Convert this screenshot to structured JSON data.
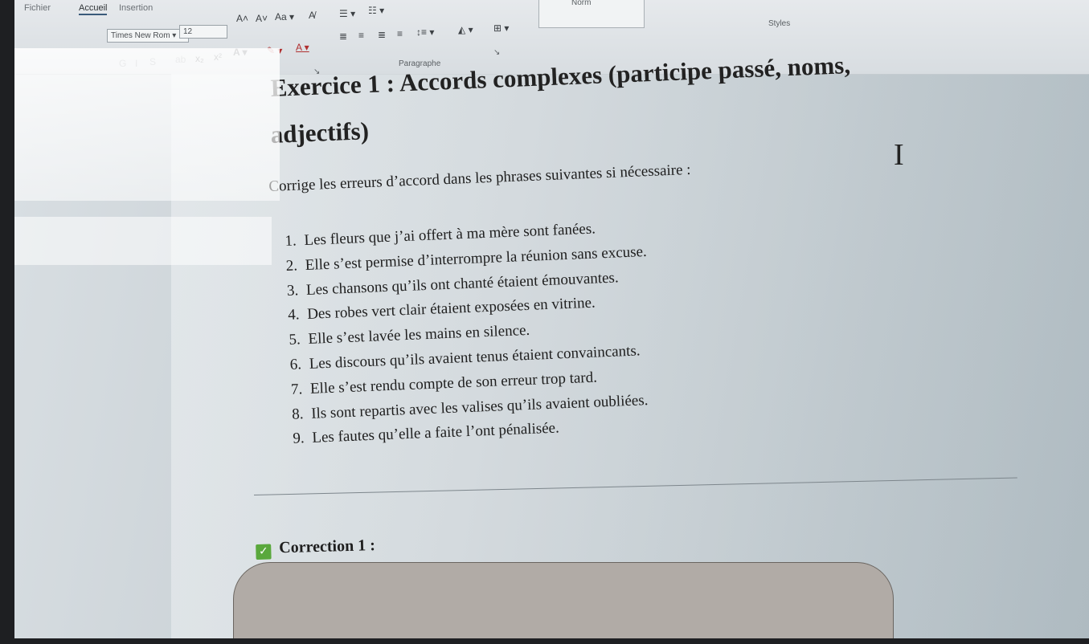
{
  "ribbon": {
    "tabs": [
      "Fichier",
      "Accueil",
      "Insertion"
    ],
    "font_name": "Times New Rom",
    "font_size": "12",
    "labels": {
      "paragraph": "Paragraphe",
      "styles": "Styles",
      "style_name": "Norm"
    },
    "buttons": {
      "grow": "A˄",
      "shrink": "A˅",
      "case": "Aa ▾",
      "bold": "G",
      "italic": "I",
      "underline": "S",
      "strike": "ab",
      "subscript": "x₂",
      "superscript": "x²"
    }
  },
  "document": {
    "title_line1": "Exercice 1 : Accords complexes (participe passé, noms,",
    "title_line2": "adjectifs)",
    "instruction": "Corrige les erreurs d’accord dans les phrases suivantes si nécessaire :",
    "items": [
      {
        "num": "1.",
        "text": "Les fleurs que j’ai offert à ma mère sont fanées."
      },
      {
        "num": "2.",
        "text": "Elle s’est permise d’interrompre la réunion sans excuse."
      },
      {
        "num": "3.",
        "text": "Les chansons qu’ils ont chanté étaient émouvantes."
      },
      {
        "num": "4.",
        "text": "Des robes vert clair étaient exposées en vitrine."
      },
      {
        "num": "5.",
        "text": "Elle s’est lavée les mains en silence."
      },
      {
        "num": "6.",
        "text": "Les discours qu’ils avaient tenus étaient convaincants."
      },
      {
        "num": "7.",
        "text": "Elle s’est rendu compte de son erreur trop tard."
      },
      {
        "num": "8.",
        "text": "Ils sont repartis avec les valises qu’ils avaient oubliées."
      },
      {
        "num": "9.",
        "text": "Les fautes qu’elle a faite l’ont pénalisée."
      }
    ],
    "correction_heading": "Correction 1 :"
  }
}
